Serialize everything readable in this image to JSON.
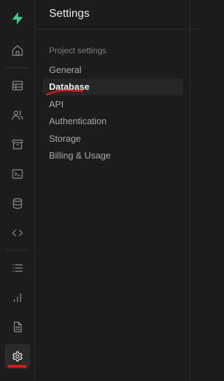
{
  "panel": {
    "title": "Settings",
    "section_label": "Project settings",
    "items": [
      {
        "label": "General",
        "active": false
      },
      {
        "label": "Database",
        "active": true
      },
      {
        "label": "API",
        "active": false
      },
      {
        "label": "Authentication",
        "active": false
      },
      {
        "label": "Storage",
        "active": false
      },
      {
        "label": "Billing & Usage",
        "active": false
      }
    ]
  },
  "rail": {
    "logo": "supabase-logo",
    "icons": [
      "home-icon",
      "table-editor-icon",
      "users-icon",
      "storage-archive-icon",
      "terminal-icon",
      "database-icon",
      "code-icon",
      "list-icon",
      "bar-chart-icon",
      "document-icon",
      "gear-icon"
    ],
    "active_icon": "gear-icon"
  },
  "colors": {
    "background": "#1c1c1c",
    "brand_green": "#3ecf8e",
    "annotation_red": "#e01818"
  }
}
